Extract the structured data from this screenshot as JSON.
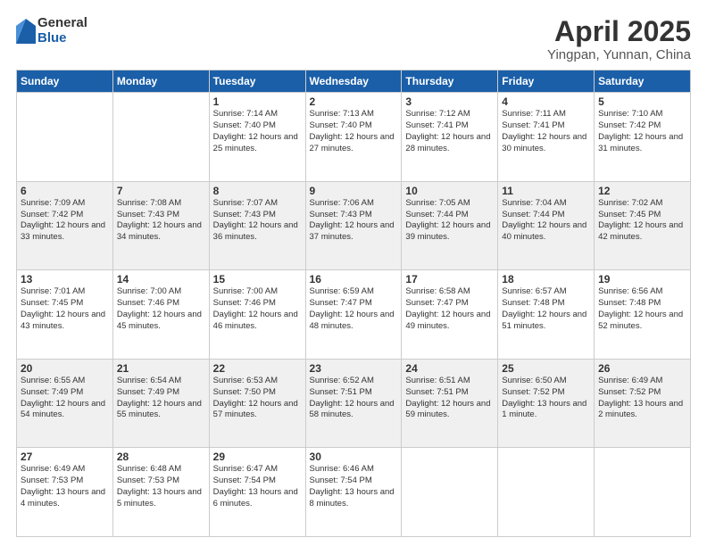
{
  "logo": {
    "general": "General",
    "blue": "Blue"
  },
  "title": {
    "main": "April 2025",
    "sub": "Yingpan, Yunnan, China"
  },
  "weekdays": [
    "Sunday",
    "Monday",
    "Tuesday",
    "Wednesday",
    "Thursday",
    "Friday",
    "Saturday"
  ],
  "weeks": [
    [
      {
        "day": "",
        "info": ""
      },
      {
        "day": "",
        "info": ""
      },
      {
        "day": "1",
        "info": "Sunrise: 7:14 AM\nSunset: 7:40 PM\nDaylight: 12 hours and 25 minutes."
      },
      {
        "day": "2",
        "info": "Sunrise: 7:13 AM\nSunset: 7:40 PM\nDaylight: 12 hours and 27 minutes."
      },
      {
        "day": "3",
        "info": "Sunrise: 7:12 AM\nSunset: 7:41 PM\nDaylight: 12 hours and 28 minutes."
      },
      {
        "day": "4",
        "info": "Sunrise: 7:11 AM\nSunset: 7:41 PM\nDaylight: 12 hours and 30 minutes."
      },
      {
        "day": "5",
        "info": "Sunrise: 7:10 AM\nSunset: 7:42 PM\nDaylight: 12 hours and 31 minutes."
      }
    ],
    [
      {
        "day": "6",
        "info": "Sunrise: 7:09 AM\nSunset: 7:42 PM\nDaylight: 12 hours and 33 minutes."
      },
      {
        "day": "7",
        "info": "Sunrise: 7:08 AM\nSunset: 7:43 PM\nDaylight: 12 hours and 34 minutes."
      },
      {
        "day": "8",
        "info": "Sunrise: 7:07 AM\nSunset: 7:43 PM\nDaylight: 12 hours and 36 minutes."
      },
      {
        "day": "9",
        "info": "Sunrise: 7:06 AM\nSunset: 7:43 PM\nDaylight: 12 hours and 37 minutes."
      },
      {
        "day": "10",
        "info": "Sunrise: 7:05 AM\nSunset: 7:44 PM\nDaylight: 12 hours and 39 minutes."
      },
      {
        "day": "11",
        "info": "Sunrise: 7:04 AM\nSunset: 7:44 PM\nDaylight: 12 hours and 40 minutes."
      },
      {
        "day": "12",
        "info": "Sunrise: 7:02 AM\nSunset: 7:45 PM\nDaylight: 12 hours and 42 minutes."
      }
    ],
    [
      {
        "day": "13",
        "info": "Sunrise: 7:01 AM\nSunset: 7:45 PM\nDaylight: 12 hours and 43 minutes."
      },
      {
        "day": "14",
        "info": "Sunrise: 7:00 AM\nSunset: 7:46 PM\nDaylight: 12 hours and 45 minutes."
      },
      {
        "day": "15",
        "info": "Sunrise: 7:00 AM\nSunset: 7:46 PM\nDaylight: 12 hours and 46 minutes."
      },
      {
        "day": "16",
        "info": "Sunrise: 6:59 AM\nSunset: 7:47 PM\nDaylight: 12 hours and 48 minutes."
      },
      {
        "day": "17",
        "info": "Sunrise: 6:58 AM\nSunset: 7:47 PM\nDaylight: 12 hours and 49 minutes."
      },
      {
        "day": "18",
        "info": "Sunrise: 6:57 AM\nSunset: 7:48 PM\nDaylight: 12 hours and 51 minutes."
      },
      {
        "day": "19",
        "info": "Sunrise: 6:56 AM\nSunset: 7:48 PM\nDaylight: 12 hours and 52 minutes."
      }
    ],
    [
      {
        "day": "20",
        "info": "Sunrise: 6:55 AM\nSunset: 7:49 PM\nDaylight: 12 hours and 54 minutes."
      },
      {
        "day": "21",
        "info": "Sunrise: 6:54 AM\nSunset: 7:49 PM\nDaylight: 12 hours and 55 minutes."
      },
      {
        "day": "22",
        "info": "Sunrise: 6:53 AM\nSunset: 7:50 PM\nDaylight: 12 hours and 57 minutes."
      },
      {
        "day": "23",
        "info": "Sunrise: 6:52 AM\nSunset: 7:51 PM\nDaylight: 12 hours and 58 minutes."
      },
      {
        "day": "24",
        "info": "Sunrise: 6:51 AM\nSunset: 7:51 PM\nDaylight: 12 hours and 59 minutes."
      },
      {
        "day": "25",
        "info": "Sunrise: 6:50 AM\nSunset: 7:52 PM\nDaylight: 13 hours and 1 minute."
      },
      {
        "day": "26",
        "info": "Sunrise: 6:49 AM\nSunset: 7:52 PM\nDaylight: 13 hours and 2 minutes."
      }
    ],
    [
      {
        "day": "27",
        "info": "Sunrise: 6:49 AM\nSunset: 7:53 PM\nDaylight: 13 hours and 4 minutes."
      },
      {
        "day": "28",
        "info": "Sunrise: 6:48 AM\nSunset: 7:53 PM\nDaylight: 13 hours and 5 minutes."
      },
      {
        "day": "29",
        "info": "Sunrise: 6:47 AM\nSunset: 7:54 PM\nDaylight: 13 hours and 6 minutes."
      },
      {
        "day": "30",
        "info": "Sunrise: 6:46 AM\nSunset: 7:54 PM\nDaylight: 13 hours and 8 minutes."
      },
      {
        "day": "",
        "info": ""
      },
      {
        "day": "",
        "info": ""
      },
      {
        "day": "",
        "info": ""
      }
    ]
  ]
}
